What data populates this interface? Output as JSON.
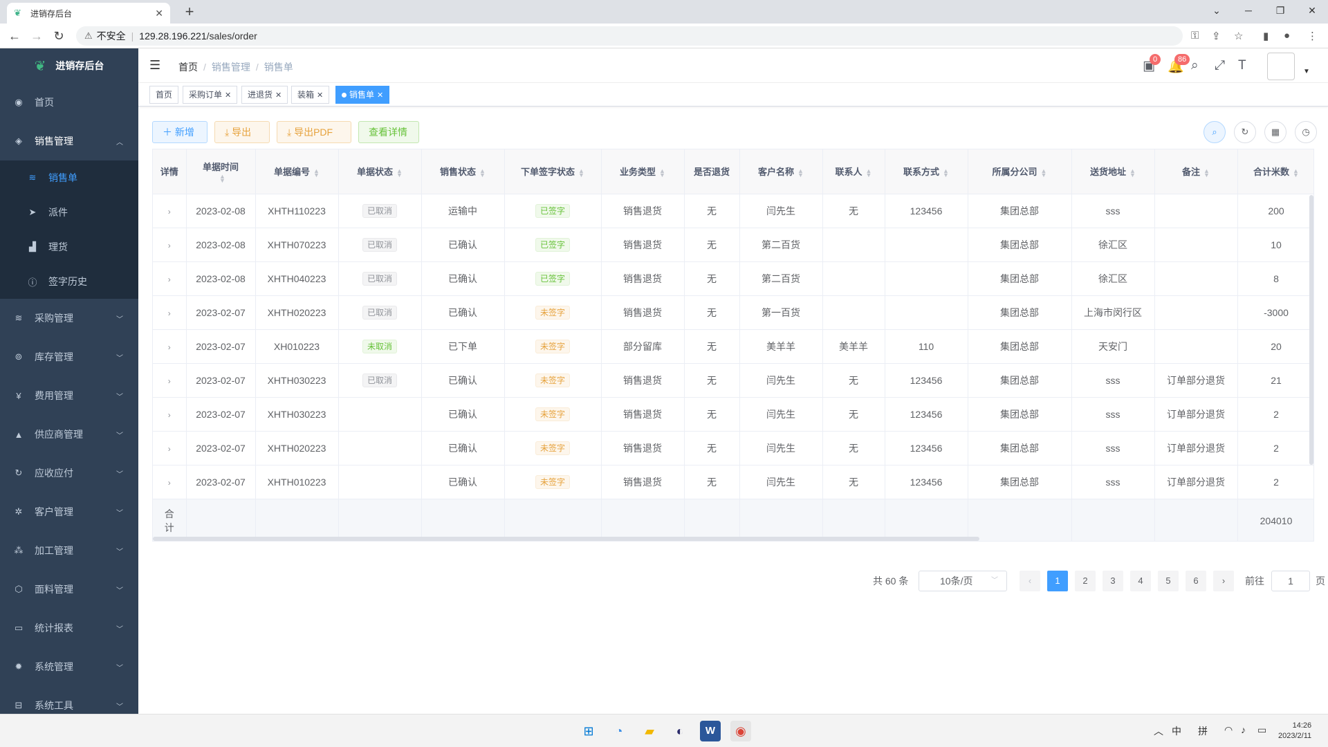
{
  "browser": {
    "tab_title": "进销存后台",
    "url_warning": "不安全",
    "url_host": "129.28.196.221",
    "url_path": "/sales/order"
  },
  "sidebar": {
    "logo": "进销存后台",
    "home": "首页",
    "sales": "销售管理",
    "sub": [
      {
        "label": "销售单",
        "icon": "layers-icon"
      },
      {
        "label": "派件",
        "icon": "send-icon"
      },
      {
        "label": "理货",
        "icon": "bar-chart-icon"
      },
      {
        "label": "签字历史",
        "icon": "info-icon"
      }
    ],
    "menus": [
      {
        "label": "采购管理",
        "icon": "layers-icon"
      },
      {
        "label": "库存管理",
        "icon": "settings-icon"
      },
      {
        "label": "费用管理",
        "icon": "yen-icon"
      },
      {
        "label": "供应商管理",
        "icon": "triangle-icon"
      },
      {
        "label": "应收应付",
        "icon": "sync-icon"
      },
      {
        "label": "客户管理",
        "icon": "gear-icon"
      },
      {
        "label": "加工管理",
        "icon": "cubes-icon"
      },
      {
        "label": "面料管理",
        "icon": "box-icon"
      },
      {
        "label": "统计报表",
        "icon": "monitor-icon"
      },
      {
        "label": "系统管理",
        "icon": "cog-icon"
      },
      {
        "label": "系统工具",
        "icon": "toolbox-icon"
      }
    ]
  },
  "breadcrumb": [
    "首页",
    "销售管理",
    "销售单"
  ],
  "badges": {
    "cart": "0",
    "bell": "86"
  },
  "tags": [
    "首页",
    "采购订单",
    "进退货",
    "装箱",
    "销售单"
  ],
  "toolbar": {
    "add": "新增",
    "export": "导出",
    "export_pdf": "导出PDF",
    "view": "查看详情"
  },
  "table": {
    "headers": [
      "详情",
      "单据时间",
      "单据编号",
      "单据状态",
      "销售状态",
      "下单签字状态",
      "业务类型",
      "是否退货",
      "客户名称",
      "联系人",
      "联系方式",
      "所属分公司",
      "送货地址",
      "备注",
      "合计米数"
    ],
    "rows": [
      [
        "2023-02-08",
        "XHTH110223",
        "已取消",
        "运输中",
        "已签字",
        "销售退货",
        "无",
        "闫先生",
        "无",
        "123456",
        "集团总部",
        "sss",
        "",
        "200"
      ],
      [
        "2023-02-08",
        "XHTH070223",
        "已取消",
        "已确认",
        "已签字",
        "销售退货",
        "无",
        "第二百货",
        "",
        "",
        "集团总部",
        "徐汇区",
        "",
        "10"
      ],
      [
        "2023-02-08",
        "XHTH040223",
        "已取消",
        "已确认",
        "已签字",
        "销售退货",
        "无",
        "第二百货",
        "",
        "",
        "集团总部",
        "徐汇区",
        "",
        "8"
      ],
      [
        "2023-02-07",
        "XHTH020223",
        "已取消",
        "已确认",
        "未签字",
        "销售退货",
        "无",
        "第一百货",
        "",
        "",
        "集团总部",
        "上海市闵行区",
        "",
        "-3000"
      ],
      [
        "2023-02-07",
        "XH010223",
        "未取消",
        "已下单",
        "未签字",
        "部分留库",
        "无",
        "美羊羊",
        "美羊羊",
        "110",
        "集团总部",
        "天安门",
        "",
        "20"
      ],
      [
        "2023-02-07",
        "XHTH030223",
        "已取消",
        "已确认",
        "未签字",
        "销售退货",
        "无",
        "闫先生",
        "无",
        "123456",
        "集团总部",
        "sss",
        "订单部分退货",
        "21"
      ],
      [
        "2023-02-07",
        "XHTH030223",
        "",
        "已确认",
        "未签字",
        "销售退货",
        "无",
        "闫先生",
        "无",
        "123456",
        "集团总部",
        "sss",
        "订单部分退货",
        "2"
      ],
      [
        "2023-02-07",
        "XHTH020223",
        "",
        "已确认",
        "未签字",
        "销售退货",
        "无",
        "闫先生",
        "无",
        "123456",
        "集团总部",
        "sss",
        "订单部分退货",
        "2"
      ],
      [
        "2023-02-07",
        "XHTH010223",
        "",
        "已确认",
        "未签字",
        "销售退货",
        "无",
        "闫先生",
        "无",
        "123456",
        "集团总部",
        "sss",
        "订单部分退货",
        "2"
      ]
    ],
    "sum_label": "合计",
    "sum_value": "204010"
  },
  "pagination": {
    "total": "共 60 条",
    "size": "10条/页",
    "pages": [
      "1",
      "2",
      "3",
      "4",
      "5",
      "6"
    ],
    "goto": "前往",
    "page_value": "1",
    "page_unit": "页"
  },
  "taskbar": {
    "ime1": "中",
    "ime2": "拼",
    "time": "14:26",
    "date": "2023/2/11"
  }
}
